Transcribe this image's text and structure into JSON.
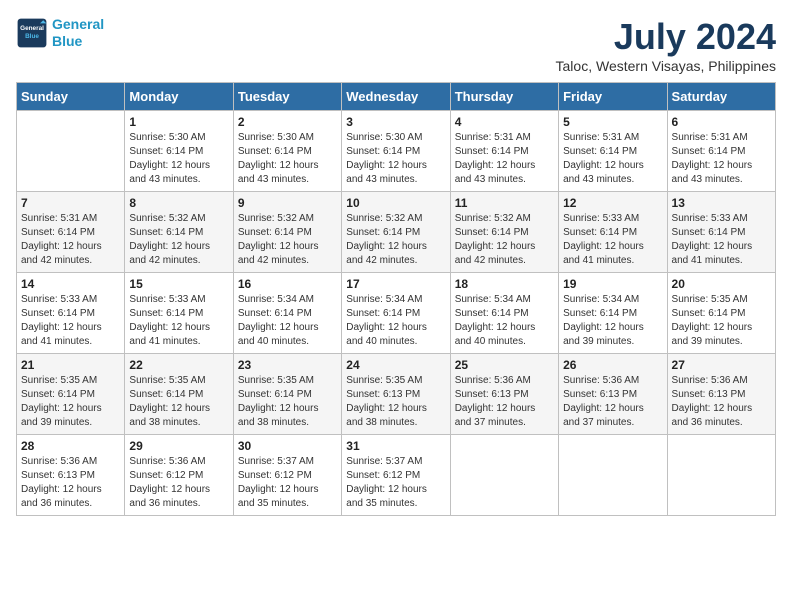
{
  "logo": {
    "line1": "General",
    "line2": "Blue"
  },
  "title": "July 2024",
  "location": "Taloc, Western Visayas, Philippines",
  "days_header": [
    "Sunday",
    "Monday",
    "Tuesday",
    "Wednesday",
    "Thursday",
    "Friday",
    "Saturday"
  ],
  "weeks": [
    [
      {
        "day": "",
        "info": ""
      },
      {
        "day": "1",
        "info": "Sunrise: 5:30 AM\nSunset: 6:14 PM\nDaylight: 12 hours\nand 43 minutes."
      },
      {
        "day": "2",
        "info": "Sunrise: 5:30 AM\nSunset: 6:14 PM\nDaylight: 12 hours\nand 43 minutes."
      },
      {
        "day": "3",
        "info": "Sunrise: 5:30 AM\nSunset: 6:14 PM\nDaylight: 12 hours\nand 43 minutes."
      },
      {
        "day": "4",
        "info": "Sunrise: 5:31 AM\nSunset: 6:14 PM\nDaylight: 12 hours\nand 43 minutes."
      },
      {
        "day": "5",
        "info": "Sunrise: 5:31 AM\nSunset: 6:14 PM\nDaylight: 12 hours\nand 43 minutes."
      },
      {
        "day": "6",
        "info": "Sunrise: 5:31 AM\nSunset: 6:14 PM\nDaylight: 12 hours\nand 43 minutes."
      }
    ],
    [
      {
        "day": "7",
        "info": "Sunrise: 5:31 AM\nSunset: 6:14 PM\nDaylight: 12 hours\nand 42 minutes."
      },
      {
        "day": "8",
        "info": "Sunrise: 5:32 AM\nSunset: 6:14 PM\nDaylight: 12 hours\nand 42 minutes."
      },
      {
        "day": "9",
        "info": "Sunrise: 5:32 AM\nSunset: 6:14 PM\nDaylight: 12 hours\nand 42 minutes."
      },
      {
        "day": "10",
        "info": "Sunrise: 5:32 AM\nSunset: 6:14 PM\nDaylight: 12 hours\nand 42 minutes."
      },
      {
        "day": "11",
        "info": "Sunrise: 5:32 AM\nSunset: 6:14 PM\nDaylight: 12 hours\nand 42 minutes."
      },
      {
        "day": "12",
        "info": "Sunrise: 5:33 AM\nSunset: 6:14 PM\nDaylight: 12 hours\nand 41 minutes."
      },
      {
        "day": "13",
        "info": "Sunrise: 5:33 AM\nSunset: 6:14 PM\nDaylight: 12 hours\nand 41 minutes."
      }
    ],
    [
      {
        "day": "14",
        "info": "Sunrise: 5:33 AM\nSunset: 6:14 PM\nDaylight: 12 hours\nand 41 minutes."
      },
      {
        "day": "15",
        "info": "Sunrise: 5:33 AM\nSunset: 6:14 PM\nDaylight: 12 hours\nand 41 minutes."
      },
      {
        "day": "16",
        "info": "Sunrise: 5:34 AM\nSunset: 6:14 PM\nDaylight: 12 hours\nand 40 minutes."
      },
      {
        "day": "17",
        "info": "Sunrise: 5:34 AM\nSunset: 6:14 PM\nDaylight: 12 hours\nand 40 minutes."
      },
      {
        "day": "18",
        "info": "Sunrise: 5:34 AM\nSunset: 6:14 PM\nDaylight: 12 hours\nand 40 minutes."
      },
      {
        "day": "19",
        "info": "Sunrise: 5:34 AM\nSunset: 6:14 PM\nDaylight: 12 hours\nand 39 minutes."
      },
      {
        "day": "20",
        "info": "Sunrise: 5:35 AM\nSunset: 6:14 PM\nDaylight: 12 hours\nand 39 minutes."
      }
    ],
    [
      {
        "day": "21",
        "info": "Sunrise: 5:35 AM\nSunset: 6:14 PM\nDaylight: 12 hours\nand 39 minutes."
      },
      {
        "day": "22",
        "info": "Sunrise: 5:35 AM\nSunset: 6:14 PM\nDaylight: 12 hours\nand 38 minutes."
      },
      {
        "day": "23",
        "info": "Sunrise: 5:35 AM\nSunset: 6:14 PM\nDaylight: 12 hours\nand 38 minutes."
      },
      {
        "day": "24",
        "info": "Sunrise: 5:35 AM\nSunset: 6:13 PM\nDaylight: 12 hours\nand 38 minutes."
      },
      {
        "day": "25",
        "info": "Sunrise: 5:36 AM\nSunset: 6:13 PM\nDaylight: 12 hours\nand 37 minutes."
      },
      {
        "day": "26",
        "info": "Sunrise: 5:36 AM\nSunset: 6:13 PM\nDaylight: 12 hours\nand 37 minutes."
      },
      {
        "day": "27",
        "info": "Sunrise: 5:36 AM\nSunset: 6:13 PM\nDaylight: 12 hours\nand 36 minutes."
      }
    ],
    [
      {
        "day": "28",
        "info": "Sunrise: 5:36 AM\nSunset: 6:13 PM\nDaylight: 12 hours\nand 36 minutes."
      },
      {
        "day": "29",
        "info": "Sunrise: 5:36 AM\nSunset: 6:12 PM\nDaylight: 12 hours\nand 36 minutes."
      },
      {
        "day": "30",
        "info": "Sunrise: 5:37 AM\nSunset: 6:12 PM\nDaylight: 12 hours\nand 35 minutes."
      },
      {
        "day": "31",
        "info": "Sunrise: 5:37 AM\nSunset: 6:12 PM\nDaylight: 12 hours\nand 35 minutes."
      },
      {
        "day": "",
        "info": ""
      },
      {
        "day": "",
        "info": ""
      },
      {
        "day": "",
        "info": ""
      }
    ]
  ]
}
